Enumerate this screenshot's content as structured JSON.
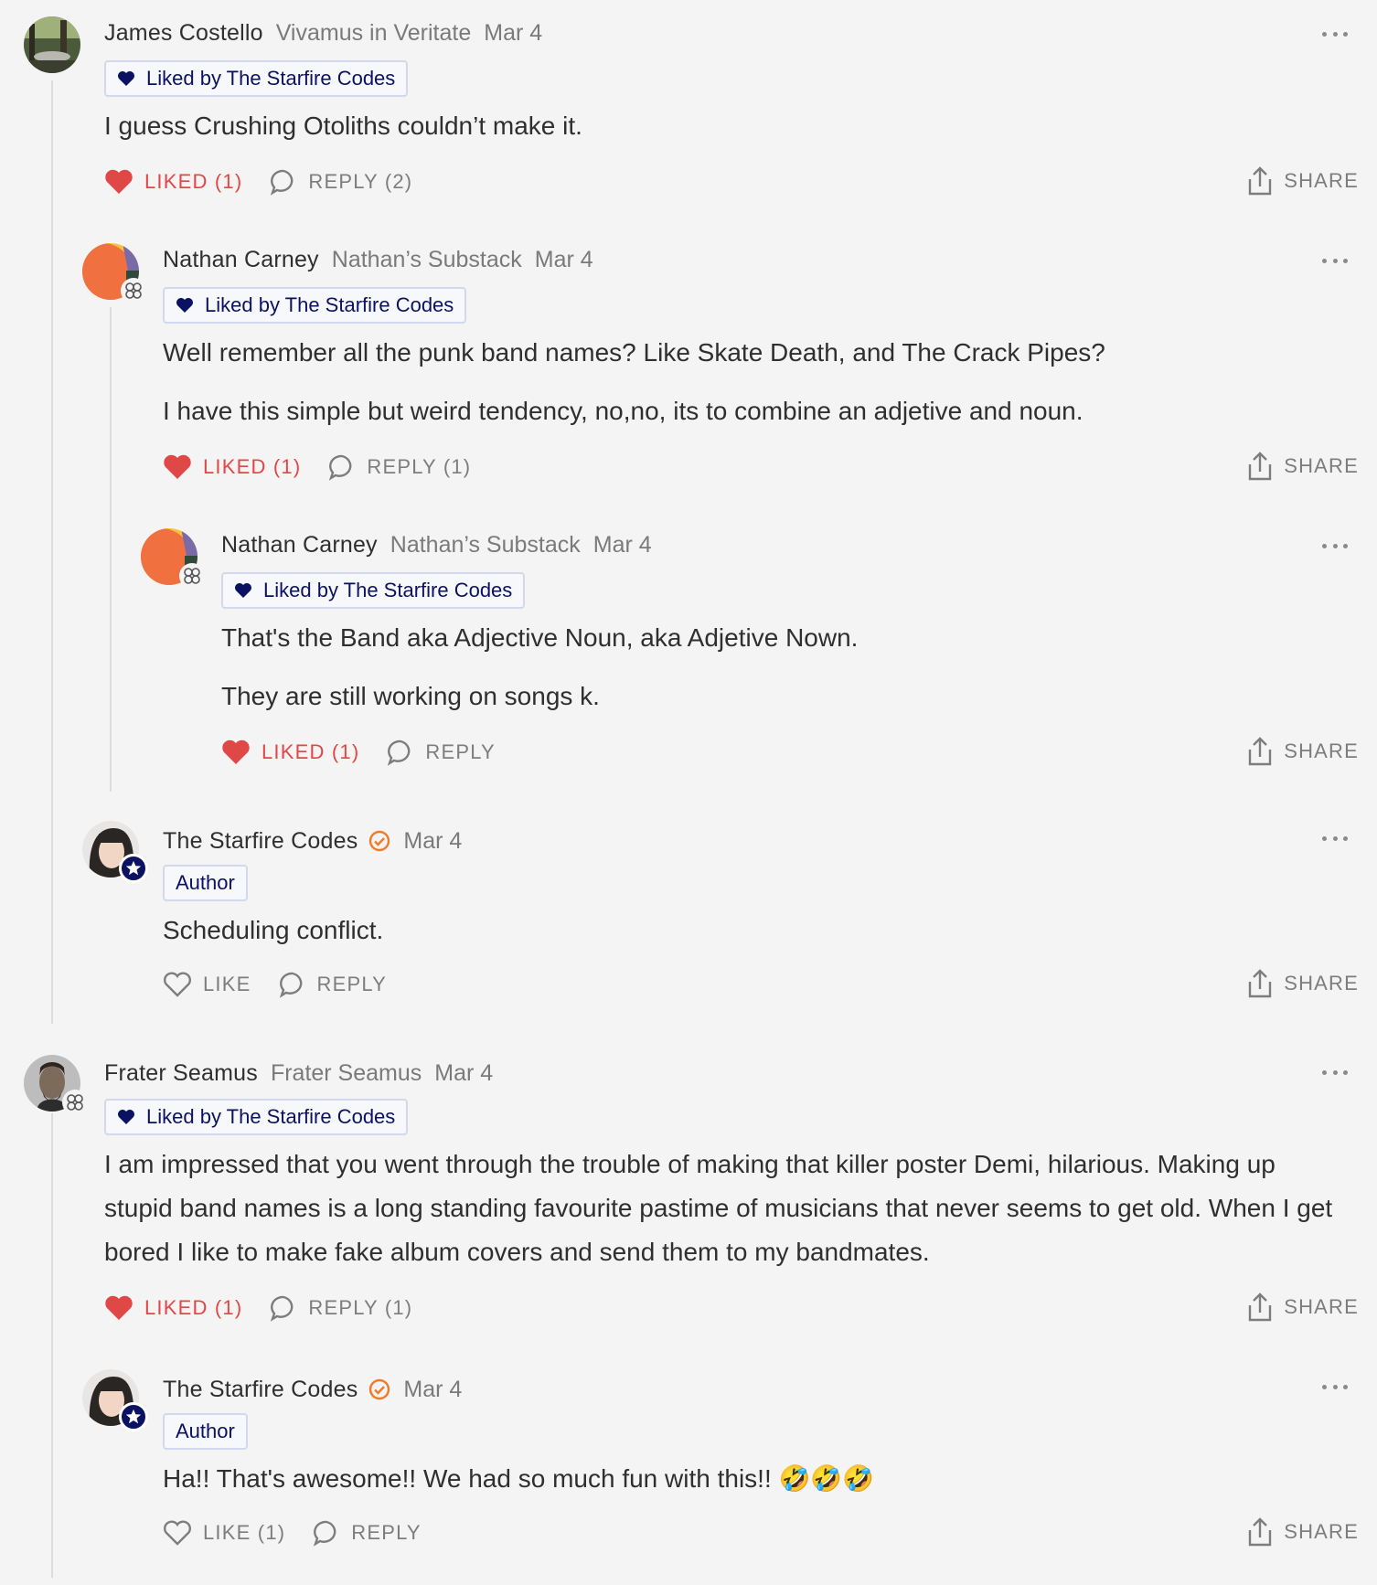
{
  "comments": [
    {
      "name": "James Costello",
      "pub": "Vivamus in Veritate",
      "date": "Mar 4",
      "badge": "Liked by The Starfire Codes",
      "body": [
        "I guess Crushing Otoliths couldn’t make it."
      ],
      "like": "LIKED (1)",
      "reply": "REPLY (2)",
      "share": "SHARE"
    },
    {
      "name": "Nathan Carney",
      "pub": "Nathan’s Substack",
      "date": "Mar 4",
      "badge": "Liked by The Starfire Codes",
      "body": [
        "Well remember all the punk band names? Like Skate Death, and The Crack Pipes?",
        "I have this simple but weird tendency, no,no, its to combine an adjetive and noun."
      ],
      "like": "LIKED (1)",
      "reply": "REPLY (1)",
      "share": "SHARE"
    },
    {
      "name": "Nathan Carney",
      "pub": "Nathan’s Substack",
      "date": "Mar 4",
      "badge": "Liked by The Starfire Codes",
      "body": [
        "That's the Band aka Adjective Noun, aka Adjetive Nown.",
        "They are still working on songs k."
      ],
      "like": "LIKED (1)",
      "reply": "REPLY",
      "share": "SHARE"
    },
    {
      "name": "The Starfire Codes",
      "date": "Mar 4",
      "badge": "Author",
      "body": [
        "Scheduling conflict."
      ],
      "like": "LIKE",
      "reply": "REPLY",
      "share": "SHARE"
    },
    {
      "name": "Frater Seamus",
      "pub": "Frater Seamus",
      "date": "Mar 4",
      "badge": "Liked by The Starfire Codes",
      "body": [
        "I am impressed that you went through the trouble of making that killer poster Demi, hilarious. Making up stupid band names is a long standing favourite pastime of musicians that never seems to get old. When I get bored I like to make fake album covers and send them to my bandmates."
      ],
      "like": "LIKED (1)",
      "reply": "REPLY (1)",
      "share": "SHARE"
    },
    {
      "name": "The Starfire Codes",
      "date": "Mar 4",
      "badge": "Author",
      "body": [
        "Ha!! That's awesome!! We had so much fun with this!! 🤣🤣🤣"
      ],
      "like": "LIKE (1)",
      "reply": "REPLY",
      "share": "SHARE"
    }
  ],
  "colors": {
    "liked": "#e04848",
    "badge_text": "#0b1262",
    "verified": "#f07a2a",
    "muted": "#7d7d7d"
  },
  "icons": [
    "heart-icon",
    "heart-outline-icon",
    "comment-icon",
    "share-icon",
    "more-icon",
    "verified-icon",
    "substack-icon",
    "author-star-icon"
  ]
}
